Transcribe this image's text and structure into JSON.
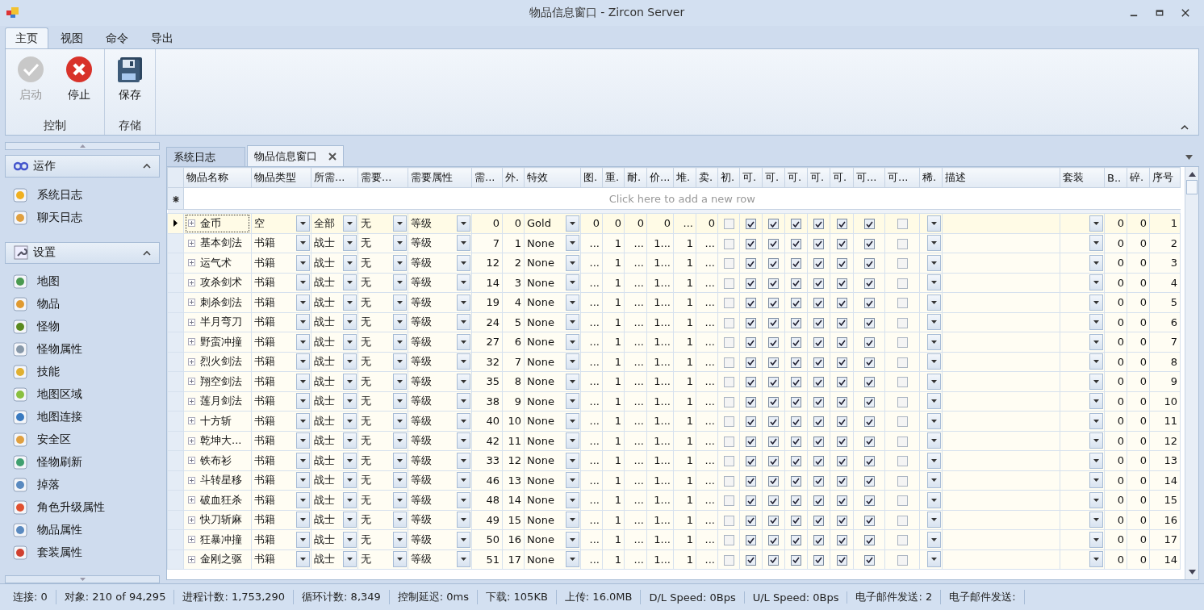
{
  "window": {
    "title": "物品信息窗口 - Zircon Server"
  },
  "ribbon": {
    "tabs": [
      {
        "label": "主页",
        "selected": true
      },
      {
        "label": "视图",
        "selected": false
      },
      {
        "label": "命令",
        "selected": false
      },
      {
        "label": "导出",
        "selected": false
      }
    ],
    "groups": [
      {
        "label": "控制",
        "buttons": [
          {
            "label": "启动",
            "kind": "start",
            "disabled": true
          },
          {
            "label": "停止",
            "kind": "stop",
            "disabled": false
          }
        ]
      },
      {
        "label": "存储",
        "buttons": [
          {
            "label": "保存",
            "kind": "save",
            "disabled": false
          }
        ]
      }
    ]
  },
  "sidebar": {
    "groups": [
      {
        "title": "运作",
        "kind": "ops",
        "expanded": true,
        "items": [
          "系统日志",
          "聊天日志"
        ]
      },
      {
        "title": "设置",
        "kind": "settings",
        "expanded": true,
        "items": [
          "地图",
          "物品",
          "怪物",
          "怪物属性",
          "技能",
          "地图区域",
          "地图连接",
          "安全区",
          "怪物刷新",
          "掉落",
          "角色升级属性",
          "物品属性",
          "套装属性"
        ]
      }
    ]
  },
  "doc_tabs": [
    {
      "label": "系统日志",
      "selected": false
    },
    {
      "label": "物品信息窗口",
      "selected": true
    }
  ],
  "grid": {
    "columns": [
      "物品名称",
      "物品类型",
      "所需...",
      "需要...",
      "需要属性",
      "需...",
      "外.",
      "特效",
      "图.",
      "重.",
      "耐.",
      "价...",
      "堆.",
      "卖.",
      "初.",
      "可.",
      "可.",
      "可.",
      "可.",
      "可.",
      "可...",
      "可...",
      "稀.",
      "描述",
      "套装",
      "B..",
      "碎.",
      "序号"
    ],
    "new_row_hint": "Click here to add a new row",
    "rows": [
      {
        "selected": true,
        "name": "金币",
        "type": "空",
        "class": "全部",
        "need": "无",
        "attr": "等级",
        "req": "0",
        "shape": "0",
        "effect": "Gold",
        "nums": [
          "0",
          "0",
          "0",
          "0",
          "...",
          "0"
        ],
        "checks": [
          false,
          true,
          true,
          true,
          true,
          true,
          true,
          false
        ],
        "b": "0",
        "broken": "0",
        "index": "1"
      },
      {
        "selected": false,
        "name": "基本剑法",
        "type": "书籍",
        "class": "战士",
        "need": "无",
        "attr": "等级",
        "req": "7",
        "shape": "1",
        "effect": "None",
        "nums": [
          "...",
          "1",
          "...",
          "1...",
          "1",
          "..."
        ],
        "checks": [
          false,
          true,
          true,
          true,
          true,
          true,
          true,
          false
        ],
        "b": "0",
        "broken": "0",
        "index": "2"
      },
      {
        "selected": false,
        "name": "运气术",
        "type": "书籍",
        "class": "战士",
        "need": "无",
        "attr": "等级",
        "req": "12",
        "shape": "2",
        "effect": "None",
        "nums": [
          "...",
          "1",
          "...",
          "1...",
          "1",
          "..."
        ],
        "checks": [
          false,
          true,
          true,
          true,
          true,
          true,
          true,
          false
        ],
        "b": "0",
        "broken": "0",
        "index": "3"
      },
      {
        "selected": false,
        "name": "攻杀剑术",
        "type": "书籍",
        "class": "战士",
        "need": "无",
        "attr": "等级",
        "req": "14",
        "shape": "3",
        "effect": "None",
        "nums": [
          "...",
          "1",
          "...",
          "1...",
          "1",
          "..."
        ],
        "checks": [
          false,
          true,
          true,
          true,
          true,
          true,
          true,
          false
        ],
        "b": "0",
        "broken": "0",
        "index": "4"
      },
      {
        "selected": false,
        "name": "刺杀剑法",
        "type": "书籍",
        "class": "战士",
        "need": "无",
        "attr": "等级",
        "req": "19",
        "shape": "4",
        "effect": "None",
        "nums": [
          "...",
          "1",
          "...",
          "1...",
          "1",
          "..."
        ],
        "checks": [
          false,
          true,
          true,
          true,
          true,
          true,
          true,
          false
        ],
        "b": "0",
        "broken": "0",
        "index": "5"
      },
      {
        "selected": false,
        "name": "半月弯刀",
        "type": "书籍",
        "class": "战士",
        "need": "无",
        "attr": "等级",
        "req": "24",
        "shape": "5",
        "effect": "None",
        "nums": [
          "...",
          "1",
          "...",
          "1...",
          "1",
          "..."
        ],
        "checks": [
          false,
          true,
          true,
          true,
          true,
          true,
          true,
          false
        ],
        "b": "0",
        "broken": "0",
        "index": "6"
      },
      {
        "selected": false,
        "name": "野蛮冲撞",
        "type": "书籍",
        "class": "战士",
        "need": "无",
        "attr": "等级",
        "req": "27",
        "shape": "6",
        "effect": "None",
        "nums": [
          "...",
          "1",
          "...",
          "1...",
          "1",
          "..."
        ],
        "checks": [
          false,
          true,
          true,
          true,
          true,
          true,
          true,
          false
        ],
        "b": "0",
        "broken": "0",
        "index": "7"
      },
      {
        "selected": false,
        "name": "烈火剑法",
        "type": "书籍",
        "class": "战士",
        "need": "无",
        "attr": "等级",
        "req": "32",
        "shape": "7",
        "effect": "None",
        "nums": [
          "...",
          "1",
          "...",
          "1...",
          "1",
          "..."
        ],
        "checks": [
          false,
          true,
          true,
          true,
          true,
          true,
          true,
          false
        ],
        "b": "0",
        "broken": "0",
        "index": "8"
      },
      {
        "selected": false,
        "name": "翔空剑法",
        "type": "书籍",
        "class": "战士",
        "need": "无",
        "attr": "等级",
        "req": "35",
        "shape": "8",
        "effect": "None",
        "nums": [
          "...",
          "1",
          "...",
          "1...",
          "1",
          "..."
        ],
        "checks": [
          false,
          true,
          true,
          true,
          true,
          true,
          true,
          false
        ],
        "b": "0",
        "broken": "0",
        "index": "9"
      },
      {
        "selected": false,
        "name": "莲月剑法",
        "type": "书籍",
        "class": "战士",
        "need": "无",
        "attr": "等级",
        "req": "38",
        "shape": "9",
        "effect": "None",
        "nums": [
          "...",
          "1",
          "...",
          "1...",
          "1",
          "..."
        ],
        "checks": [
          false,
          true,
          true,
          true,
          true,
          true,
          true,
          false
        ],
        "b": "0",
        "broken": "0",
        "index": "10"
      },
      {
        "selected": false,
        "name": "十方斩",
        "type": "书籍",
        "class": "战士",
        "need": "无",
        "attr": "等级",
        "req": "40",
        "shape": "10",
        "effect": "None",
        "nums": [
          "...",
          "1",
          "...",
          "1...",
          "1",
          "..."
        ],
        "checks": [
          false,
          true,
          true,
          true,
          true,
          true,
          true,
          false
        ],
        "b": "0",
        "broken": "0",
        "index": "11"
      },
      {
        "selected": false,
        "name": "乾坤大...",
        "type": "书籍",
        "class": "战士",
        "need": "无",
        "attr": "等级",
        "req": "42",
        "shape": "11",
        "effect": "None",
        "nums": [
          "...",
          "1",
          "...",
          "1...",
          "1",
          "..."
        ],
        "checks": [
          false,
          true,
          true,
          true,
          true,
          true,
          true,
          false
        ],
        "b": "0",
        "broken": "0",
        "index": "12"
      },
      {
        "selected": false,
        "name": "铁布衫",
        "type": "书籍",
        "class": "战士",
        "need": "无",
        "attr": "等级",
        "req": "33",
        "shape": "12",
        "effect": "None",
        "nums": [
          "...",
          "1",
          "...",
          "1...",
          "1",
          "..."
        ],
        "checks": [
          false,
          true,
          true,
          true,
          true,
          true,
          true,
          false
        ],
        "b": "0",
        "broken": "0",
        "index": "13"
      },
      {
        "selected": false,
        "name": "斗转星移",
        "type": "书籍",
        "class": "战士",
        "need": "无",
        "attr": "等级",
        "req": "46",
        "shape": "13",
        "effect": "None",
        "nums": [
          "...",
          "1",
          "...",
          "1...",
          "1",
          "..."
        ],
        "checks": [
          false,
          true,
          true,
          true,
          true,
          true,
          true,
          false
        ],
        "b": "0",
        "broken": "0",
        "index": "14"
      },
      {
        "selected": false,
        "name": "破血狂杀",
        "type": "书籍",
        "class": "战士",
        "need": "无",
        "attr": "等级",
        "req": "48",
        "shape": "14",
        "effect": "None",
        "nums": [
          "...",
          "1",
          "...",
          "1...",
          "1",
          "..."
        ],
        "checks": [
          false,
          true,
          true,
          true,
          true,
          true,
          true,
          false
        ],
        "b": "0",
        "broken": "0",
        "index": "15"
      },
      {
        "selected": false,
        "name": "快刀斩麻",
        "type": "书籍",
        "class": "战士",
        "need": "无",
        "attr": "等级",
        "req": "49",
        "shape": "15",
        "effect": "None",
        "nums": [
          "...",
          "1",
          "...",
          "1...",
          "1",
          "..."
        ],
        "checks": [
          false,
          true,
          true,
          true,
          true,
          true,
          true,
          false
        ],
        "b": "0",
        "broken": "0",
        "index": "16"
      },
      {
        "selected": false,
        "name": "狂暴冲撞",
        "type": "书籍",
        "class": "战士",
        "need": "无",
        "attr": "等级",
        "req": "50",
        "shape": "16",
        "effect": "None",
        "nums": [
          "...",
          "1",
          "...",
          "1...",
          "1",
          "..."
        ],
        "checks": [
          false,
          true,
          true,
          true,
          true,
          true,
          true,
          false
        ],
        "b": "0",
        "broken": "0",
        "index": "17"
      },
      {
        "selected": false,
        "name": "金刚之驱",
        "type": "书籍",
        "class": "战士",
        "need": "无",
        "attr": "等级",
        "req": "51",
        "shape": "17",
        "effect": "None",
        "nums": [
          "...",
          "1",
          "...",
          "1...",
          "1",
          "..."
        ],
        "checks": [
          false,
          true,
          true,
          true,
          true,
          true,
          true,
          false
        ],
        "b": "0",
        "broken": "0",
        "index": "14"
      }
    ]
  },
  "status_bar": [
    "连接: 0",
    "对象: 210 of 94,295",
    "进程计数: 1,753,290",
    "循环计数: 8,349",
    "控制延迟: 0ms",
    "下载: 105KB",
    "上传: 16.0MB",
    "D/L Speed: 0Bps",
    "U/L Speed: 0Bps",
    "电子邮件发送: 2",
    "电子邮件发送:"
  ]
}
